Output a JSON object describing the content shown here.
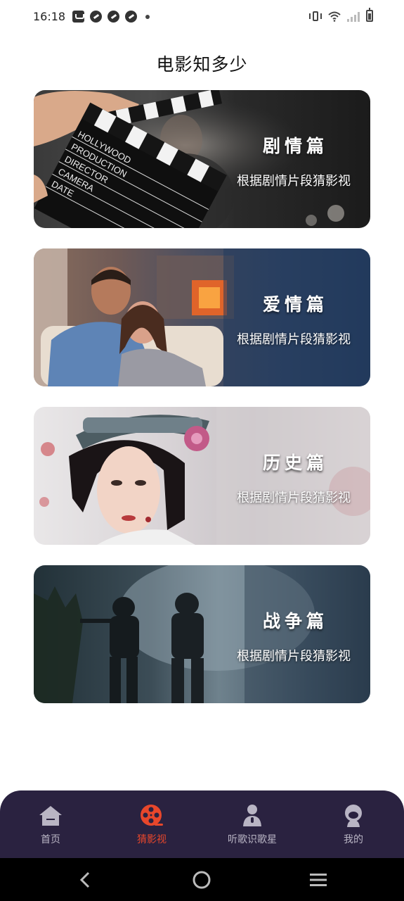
{
  "status_bar": {
    "time": "16:18",
    "left_icons": [
      "notification-icon",
      "app-icon",
      "app-icon",
      "app-icon",
      "more-dot-icon"
    ],
    "right_icons": [
      "vibrate-icon",
      "wifi-icon",
      "signal-icon",
      "battery-icon"
    ]
  },
  "page": {
    "title": "电影知多少"
  },
  "cards": [
    {
      "title": "剧情篇",
      "subtitle": "根据剧情片段猜影视"
    },
    {
      "title": "爱情篇",
      "subtitle": "根据剧情片段猜影视"
    },
    {
      "title": "历史篇",
      "subtitle": "根据剧情片段猜影视"
    },
    {
      "title": "战争篇",
      "subtitle": "根据剧情片段猜影视"
    }
  ],
  "clapboard_text": [
    "HOLLYWOOD",
    "PRODUCTION",
    "DIRECTOR",
    "CAMERA",
    "DATE"
  ],
  "bottom_nav": {
    "items": [
      {
        "label": "首页",
        "icon": "home-icon",
        "active": false
      },
      {
        "label": "猜影视",
        "icon": "film-reel-icon",
        "active": true
      },
      {
        "label": "听歌识歌星",
        "icon": "singer-icon",
        "active": false
      },
      {
        "label": "我的",
        "icon": "profile-icon",
        "active": false
      }
    ],
    "active_color": "#e8472b",
    "inactive_color": "#b9b5c4",
    "background": "#2a2240"
  },
  "system_nav": [
    "back-icon",
    "home-circle-icon",
    "recents-icon"
  ]
}
